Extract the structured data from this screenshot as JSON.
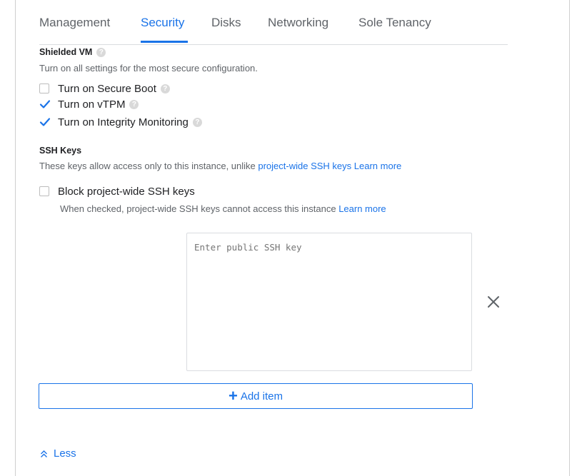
{
  "tabs": [
    {
      "label": "Management",
      "active": false
    },
    {
      "label": "Security",
      "active": true
    },
    {
      "label": "Disks",
      "active": false
    },
    {
      "label": "Networking",
      "active": false
    },
    {
      "label": "Sole Tenancy",
      "active": false
    }
  ],
  "shielded_vm": {
    "title": "Shielded VM",
    "description": "Turn on all settings for the most secure configuration.",
    "options": [
      {
        "label": "Turn on Secure Boot",
        "checked": false
      },
      {
        "label": "Turn on vTPM",
        "checked": true
      },
      {
        "label": "Turn on Integrity Monitoring",
        "checked": true
      }
    ]
  },
  "ssh_keys": {
    "title": "SSH Keys",
    "description_prefix": "These keys allow access only to this instance, unlike ",
    "description_link": "project-wide SSH keys",
    "learn_more": "Learn more",
    "block_label": "Block project-wide SSH keys",
    "block_checked": false,
    "block_help_prefix": "When checked, project-wide SSH keys cannot access this instance ",
    "block_help_link": "Learn more",
    "key_placeholder": "Enter public SSH key",
    "key_value": "",
    "add_item_label": "Add item"
  },
  "footer": {
    "less_label": "Less"
  },
  "icons": {
    "help": "help-circle-icon",
    "check": "checkmark-icon",
    "close": "close-icon",
    "plus": "plus-icon",
    "chevron": "double-chevron-up-icon"
  },
  "colors": {
    "accent": "#1a73e8",
    "text": "#202124",
    "muted": "#5f6368",
    "border": "#dadce0"
  }
}
